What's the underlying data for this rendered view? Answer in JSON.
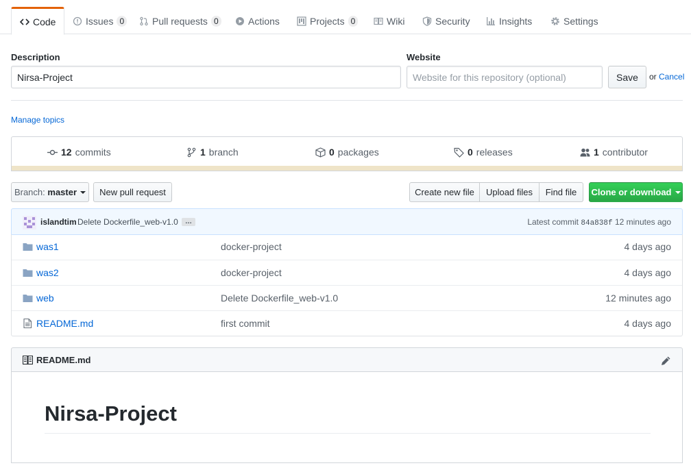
{
  "tabs": [
    {
      "label": "Code",
      "icon": "code-icon"
    },
    {
      "label": "Issues",
      "count": "0",
      "icon": "issue-icon"
    },
    {
      "label": "Pull requests",
      "count": "0",
      "icon": "pull-request-icon"
    },
    {
      "label": "Actions",
      "icon": "play-icon"
    },
    {
      "label": "Projects",
      "count": "0",
      "icon": "project-icon"
    },
    {
      "label": "Wiki",
      "icon": "book-icon"
    },
    {
      "label": "Security",
      "icon": "shield-icon"
    },
    {
      "label": "Insights",
      "icon": "graph-icon"
    },
    {
      "label": "Settings",
      "icon": "gear-icon"
    }
  ],
  "edit_form": {
    "description_label": "Description",
    "description_value": "Nirsa-Project",
    "website_label": "Website",
    "website_placeholder": "Website for this repository (optional)",
    "save_label": "Save",
    "or_text": "or",
    "cancel_label": "Cancel"
  },
  "manage_topics": "Manage topics",
  "summary": {
    "commits": {
      "count": "12",
      "label": "commits"
    },
    "branches": {
      "count": "1",
      "label": "branch"
    },
    "packages": {
      "count": "0",
      "label": "packages"
    },
    "releases": {
      "count": "0",
      "label": "releases"
    },
    "contributors": {
      "count": "1",
      "label": "contributor"
    }
  },
  "file_nav": {
    "branch_prefix": "Branch:",
    "branch_name": "master",
    "new_pr": "New pull request",
    "create_file": "Create new file",
    "upload_files": "Upload files",
    "find_file": "Find file",
    "clone": "Clone or download"
  },
  "commit": {
    "author": "islandtim",
    "message": "Delete Dockerfile_web-v1.0",
    "ellipsis": "…",
    "latest_label": "Latest commit",
    "sha": "84a838f",
    "age": "12 minutes ago"
  },
  "files": [
    {
      "name": "was1",
      "type": "dir",
      "message": "docker-project",
      "age": "4 days ago"
    },
    {
      "name": "was2",
      "type": "dir",
      "message": "docker-project",
      "age": "4 days ago"
    },
    {
      "name": "web",
      "type": "dir",
      "message": "Delete Dockerfile_web-v1.0",
      "age": "12 minutes ago"
    },
    {
      "name": "README.md",
      "type": "file",
      "message": "first commit",
      "age": "4 days ago"
    }
  ],
  "readme": {
    "filename": "README.md",
    "heading": "Nirsa-Project"
  },
  "colors": {
    "accent_tab": "#e36209",
    "link": "#0366d6",
    "clone_button": "#28a745",
    "language_bar": "#efe4c8"
  }
}
